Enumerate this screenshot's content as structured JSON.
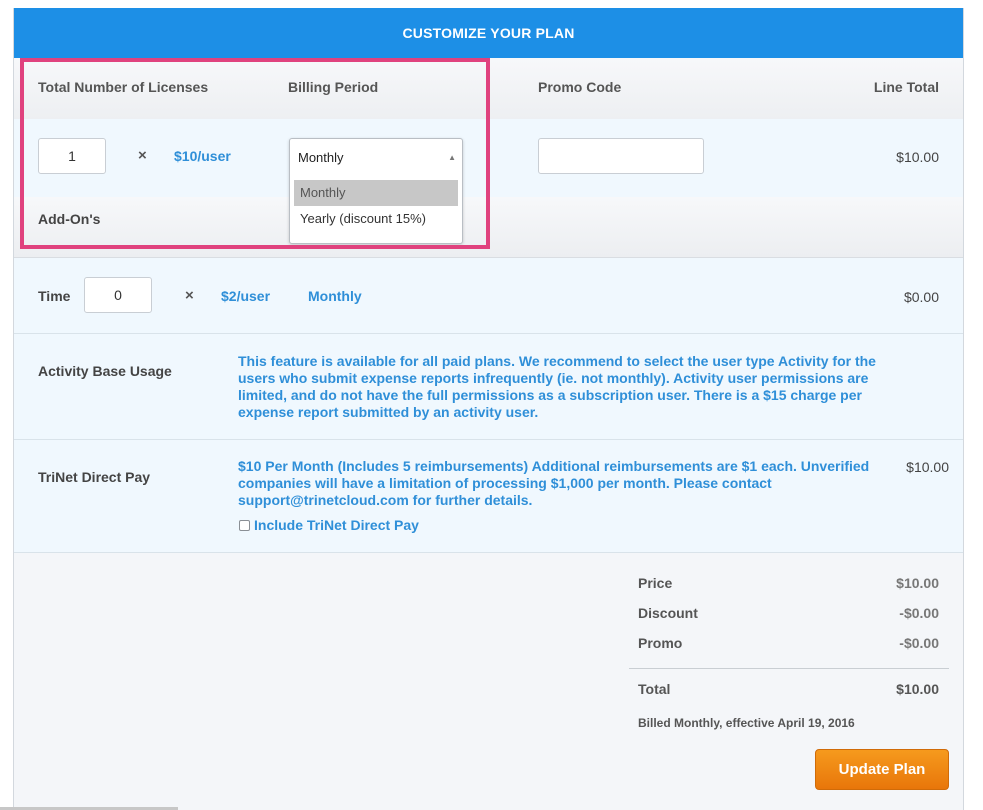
{
  "header": {
    "title": "CUSTOMIZE YOUR PLAN"
  },
  "columns": {
    "licenses": "Total Number of Licenses",
    "billing": "Billing Period",
    "promo": "Promo Code",
    "line_total": "Line Total"
  },
  "license_row": {
    "quantity": "1",
    "multiply": "×",
    "price": "$10/user",
    "billing_selected": "Monthly",
    "billing_options": [
      "Monthly",
      "Yearly (discount 15%)"
    ],
    "promo_value": "",
    "line_total": "$10.00"
  },
  "addons": {
    "title": "Add-On's",
    "time": {
      "label": "Time",
      "quantity": "0",
      "multiply": "×",
      "price": "$2/user",
      "period": "Monthly",
      "total": "$0.00"
    },
    "activity": {
      "label": "Activity Base Usage",
      "description_lines": [
        "This feature is available for all paid plans. We recommend to select the user type Activity for the",
        "users who submit expense reports infrequently (ie. not monthly). Activity user permissions are",
        "limited, and do not have the full permissions as a subscription user. There is a $15 charge per",
        "expense report submitted by an activity user."
      ]
    },
    "trinet": {
      "label": "TriNet Direct Pay",
      "description_lines": [
        "$10 Per Month (Includes 5 reimbursements) Additional reimbursements are $1 each. Unverified",
        "companies will have a limitation of processing $1,000 per month. Please contact",
        "support@trinetcloud.com for further details."
      ],
      "checkbox_label": "Include TriNet Direct Pay",
      "checked": false,
      "total": "$10.00"
    }
  },
  "summary": {
    "price_label": "Price",
    "price": "$10.00",
    "discount_label": "Discount",
    "discount": "-$0.00",
    "promo_label": "Promo",
    "promo": "-$0.00",
    "total_label": "Total",
    "total": "$10.00",
    "billing_note": "Billed Monthly, effective April 19, 2016"
  },
  "actions": {
    "update_label": "Update Plan"
  },
  "colors": {
    "header": "#1d8fe6",
    "link": "#2f8fd8",
    "button": "#f08a12",
    "highlight": "#e0427e"
  }
}
